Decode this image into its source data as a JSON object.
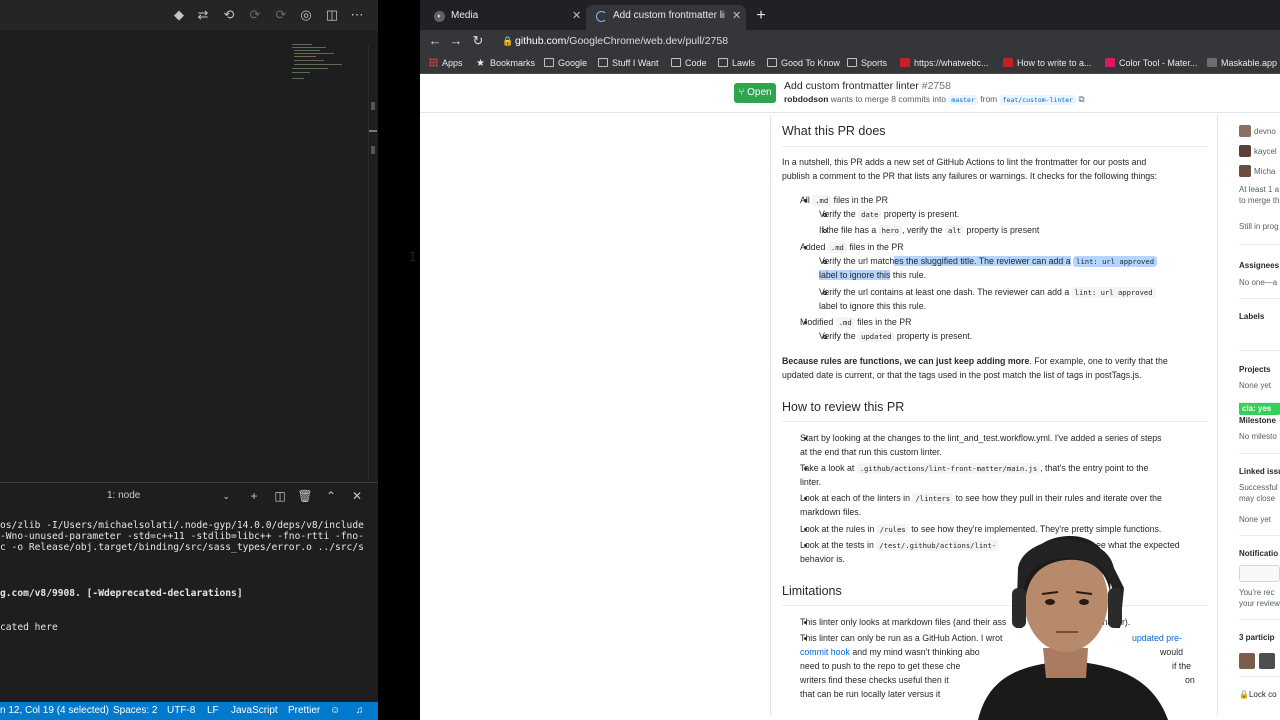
{
  "vscode": {
    "titlebar_icons": [
      "git-branch-icon",
      "pull-request-icon",
      "go-back-icon",
      "go-forward-icon",
      "go-forward-dim-icon",
      "open-changes-icon",
      "split-editor-icon",
      "more-icon"
    ],
    "terminal": {
      "selected": "1: node",
      "lines": [
        "os/zlib -I/Users/michaelsolati/.node-gyp/14.0.0/deps/v8/include",
        "-Wno-unused-parameter -std=c++11 -stdlib=libc++ -fno-rtti -fno-",
        "c -o Release/obj.target/binding/src/sass_types/error.o ../src/s",
        "g.com/v8/9908. [-Wdeprecated-declarations]",
        "cated here"
      ]
    },
    "status": {
      "position": "n 12, Col 19 (4 selected)",
      "spaces": "Spaces: 2",
      "encoding": "UTF-8",
      "eol": "LF",
      "language": "JavaScript",
      "formatter": "Prettier"
    }
  },
  "chrome": {
    "tabs": [
      {
        "title": "Media"
      },
      {
        "title": "Add custom frontmatter linter"
      }
    ],
    "url_host": "github.com",
    "url_path": "/GoogleChrome/web.dev/pull/2758",
    "bookmarks": [
      "Apps",
      "Bookmarks",
      "Google",
      "Stuff I Want",
      "Code",
      "Lawls",
      "Good To Know",
      "Sports",
      "https://whatwebc...",
      "How to write to a...",
      "Color Tool - Mater...",
      "Maskable.app Edi"
    ]
  },
  "pr": {
    "state": "Open",
    "title": "Add custom frontmatter linter",
    "number": "#2758",
    "author": "robdodson",
    "meta_mid": "wants to merge 8 commits into",
    "base_branch": "master",
    "meta_from": "from",
    "head_branch": "feat/custom-linter"
  },
  "body": {
    "h_what": "What this PR does",
    "intro_1": "In a nutshell, this PR adds a new set of GitHub Actions to lint the frontmatter for our posts and",
    "intro_2": "publish a comment to the PR that lists any failures or warnings. It checks for the following things:",
    "all": "All",
    "md": ".md",
    "files_in_pr": "files in the PR",
    "verify_the": "Verify the",
    "date": "date",
    "property_present": "property is present.",
    "if_file_has": "If the file has a",
    "hero": "hero",
    "verify_the_2": ", verify the",
    "alt": "alt",
    "property_present_2": "property is present",
    "added": "Added",
    "url_a": "Verify the url match",
    "url_b": "es the sluggified title. The reviewer can add a",
    "lint_code": "lint: url approved",
    "label_a": "label to ignore this",
    "label_b": " this rule.",
    "dash_1": "Verify the url contains at least one dash. The reviewer can add a",
    "dash_2": "label to ignore this this rule.",
    "modified": "Modified",
    "updated": "updated",
    "because_bold": "Because rules are functions, we can just keep adding more",
    "because_rest": ". For example, one to verify that the",
    "because_2": "updated date is current, or that the tags used in the post match the list of tags in postTags.js.",
    "h_review": "How to review this PR",
    "r1a": "Start by looking at the changes to the lint_and_test.workflow.yml. I've added a series of steps",
    "r1b": "at the end that run this custom linter.",
    "r2a": "Take a look at",
    "r2code": ".github/actions/lint-front-matter/main.js",
    "r2b": ", that's the entry point to the",
    "r2c": "linter.",
    "r3a": "Look at each of the linters in",
    "r3code": "/linters",
    "r3b": "to see how they pull in their rules and iterate over the",
    "r3c": "markdown files.",
    "r4a": "Look at the rules in",
    "r4code": "/rules",
    "r4b": "to see how they're implemented. They're pretty simple functions.",
    "r5a": "Look at the tests in",
    "r5code": "/test/.github/actions/lint-",
    "r5b": "ee what the expected",
    "r5c": "behavior is.",
    "h_limits": "Limitations",
    "l1a": "This linter only looks at markdown files (and their ass",
    "l1b": "matter).",
    "l2a": "This linter can only be run as a GitHub Action. I wrot",
    "l2link": "updated pre-",
    "l2link2": "commit hook",
    "l2b": "and my mind wasn't thinking abo",
    "l2c": "would",
    "l2d": "need to push to the repo to get these che",
    "l2e": "if the",
    "l2f": "writers find these checks useful then it",
    "l2g": "on",
    "l2h": "that can be run locally later versus it"
  },
  "sidebar": {
    "reviewers": [
      "devno",
      "kaycel",
      "Micha"
    ],
    "note_1": "At least 1 a",
    "note_2": "to merge th",
    "still": "Still in prog",
    "assignees": "Assignees",
    "assignees_val": "No one—a",
    "labels": "Labels",
    "label_cla": "cla: yes",
    "projects": "Projects",
    "projects_val": "None yet",
    "milestone": "Milestone",
    "milestone_val": "No milesto",
    "linked": "Linked issu",
    "linked_1": "Successful",
    "linked_2": "may close",
    "linked_val": "None yet",
    "notif": "Notificatio",
    "notif_1": "You're rec",
    "notif_2": "your review",
    "participants": "3 particip",
    "lock": "Lock co"
  }
}
